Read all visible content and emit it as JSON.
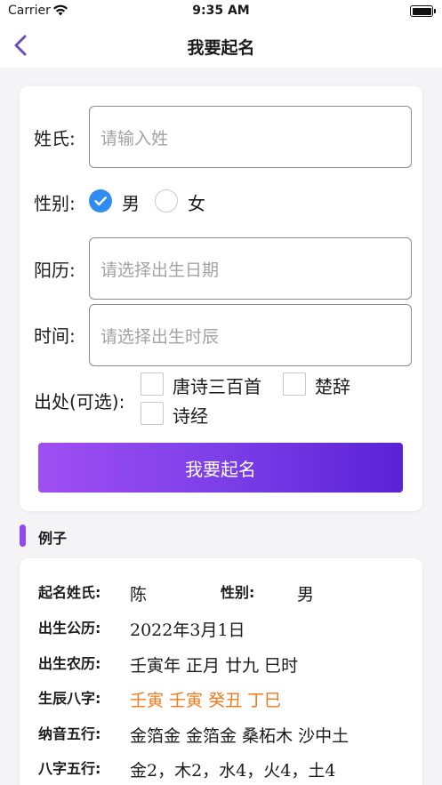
{
  "status_bar": {
    "carrier": "Carrier",
    "time": "9:35 AM"
  },
  "nav": {
    "title": "我要起名"
  },
  "form": {
    "surname": {
      "label": "姓氏:",
      "placeholder": "请输入姓"
    },
    "gender": {
      "label": "性别:",
      "options": [
        {
          "label": "男",
          "selected": true
        },
        {
          "label": "女",
          "selected": false
        }
      ]
    },
    "solar": {
      "label": "阳历:",
      "placeholder": "请选择出生日期"
    },
    "time": {
      "label": "时间:",
      "placeholder": "请选择出生时辰"
    },
    "source": {
      "label": "出处(可选):",
      "options": [
        {
          "label": "唐诗三百首",
          "checked": false
        },
        {
          "label": "楚辞",
          "checked": false
        },
        {
          "label": "诗经",
          "checked": false
        }
      ]
    },
    "submit_label": "我要起名"
  },
  "example": {
    "section_title": "例子",
    "surname_label": "起名姓氏:",
    "surname_value": "陈",
    "gender_label": "性别:",
    "gender_value": "男",
    "rows": [
      {
        "label": "出生公历:",
        "value": "2022年3月1日"
      },
      {
        "label": "出生农历:",
        "value": "壬寅年 正月 廿九 巳时"
      },
      {
        "label": "生辰八字:",
        "value": "壬寅 壬寅 癸丑 丁巳"
      },
      {
        "label": "纳音五行:",
        "value": "金箔金 金箔金 桑柘木 沙中土"
      },
      {
        "label": "八字五行:",
        "value": "金2，木2，水4，火4，土4"
      }
    ]
  },
  "colors": {
    "accent_gradient_start": "#9f4ff2",
    "accent_gradient_end": "#5a22d6",
    "radio_selected": "#2f8cf0",
    "bazi_highlight": "#f07a1c",
    "back_arrow": "#6b4fb8"
  }
}
